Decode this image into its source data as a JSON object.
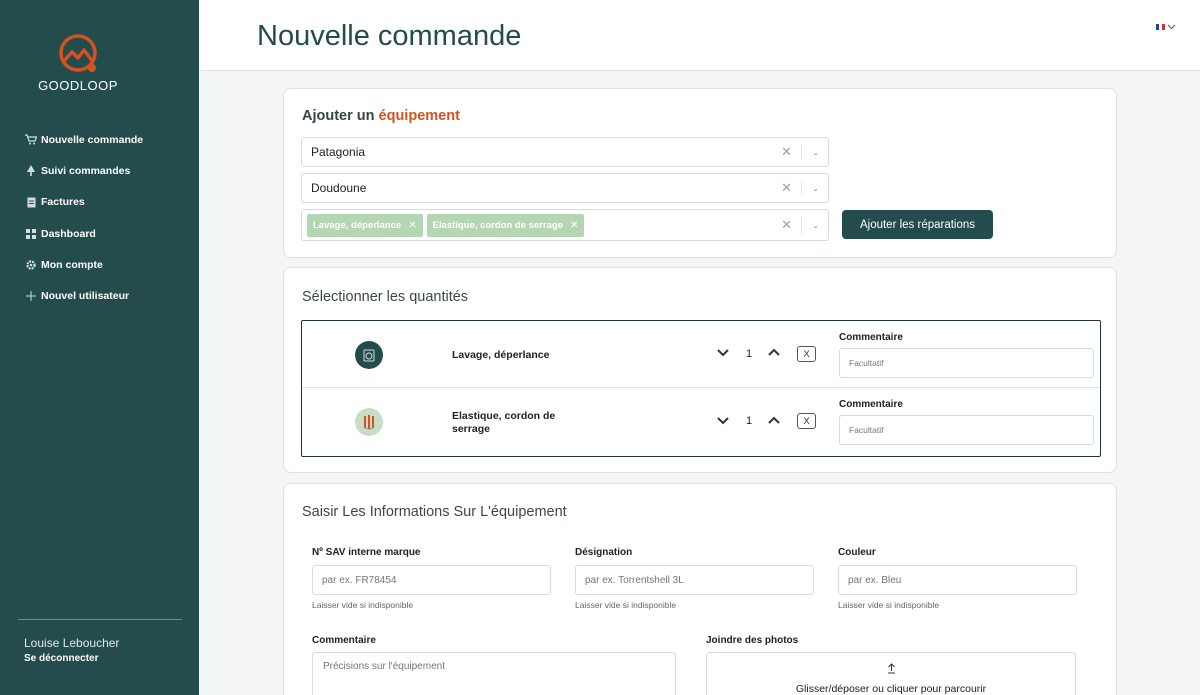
{
  "brand": {
    "name": "GOODLOOP",
    "accent": "#d4521f",
    "primary": "#244c4c"
  },
  "sidebar": {
    "items": [
      {
        "label": "Nouvelle commande",
        "icon": "cart-icon"
      },
      {
        "label": "Suivi commandes",
        "icon": "tree-icon"
      },
      {
        "label": "Factures",
        "icon": "document-icon"
      },
      {
        "label": "Dashboard",
        "icon": "grid-icon"
      },
      {
        "label": "Mon compte",
        "icon": "gear-icon"
      },
      {
        "label": "Nouvel utilisateur",
        "icon": "plus-icon"
      }
    ],
    "user_name": "Louise Leboucher",
    "logout_label": "Se déconnecter"
  },
  "header": {
    "title": "Nouvelle commande",
    "language_flag": "fr-flag-icon"
  },
  "add_equipment": {
    "title_prefix": "Ajouter un",
    "title_accent": "équipement",
    "brand_value": "Patagonia",
    "product_value": "Doudoune",
    "repairs": [
      "Lavage, déperlance",
      "Elastique, cordon de serrage"
    ],
    "add_button": "Ajouter les réparations"
  },
  "quantities": {
    "title": "Sélectionner les quantités",
    "comment_label": "Commentaire",
    "comment_placeholder": "Facultatif",
    "rows": [
      {
        "name": "Lavage, déperlance",
        "qty": "1"
      },
      {
        "name": "Elastique, cordon de serrage",
        "qty": "1"
      }
    ],
    "remove_label": "X"
  },
  "equipment_info": {
    "title": "Saisir Les Informations Sur L'équipement",
    "sav_label": "Nº SAV interne marque",
    "sav_placeholder": "par ex. FR78454",
    "designation_label": "Désignation",
    "designation_placeholder": "par ex. Torrentshell 3L",
    "color_label": "Couleur",
    "color_placeholder": "par ex. Bleu",
    "hint": "Laisser vide si indisponible",
    "comment_label": "Commentaire",
    "comment_placeholder": "Précisions sur l'équipement",
    "photos_label": "Joindre des photos",
    "drop_text": "Glisser/déposer ou cliquer pour parcourir"
  }
}
